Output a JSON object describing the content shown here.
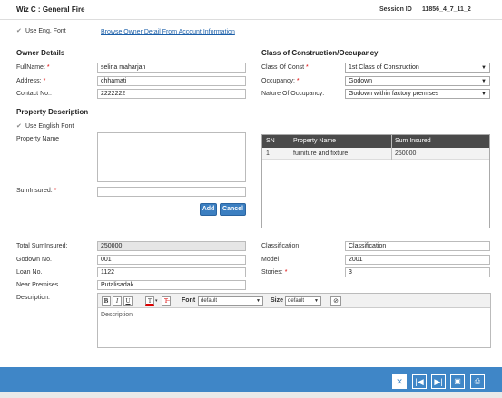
{
  "title": "Wiz C : General Fire",
  "session": {
    "label": "Session ID",
    "value": "11856_4_7_11_2"
  },
  "use_eng_font": {
    "label": "Use Eng. Font",
    "checked": true
  },
  "owner_link": "Browse Owner Detail From Account Information",
  "owner": {
    "heading": "Owner Details",
    "fullname_label": "FullName:",
    "fullname": "selina maharjan",
    "address_label": "Address:",
    "address": "chhamati",
    "contact_label": "Contact No.:",
    "contact": "2222222"
  },
  "construction": {
    "heading": "Class of Construction/Occupancy",
    "class_label": "Class Of Const",
    "class_value": "1st Class of Construction",
    "occupancy_label": "Occupancy:",
    "occupancy_value": "Godown",
    "nature_label": "Nature Of Occupancy:",
    "nature_value": "Godown within factory premises"
  },
  "property": {
    "heading": "Property Description",
    "use_english_label": "Use English Font",
    "name_label": "Property Name",
    "sum_label": "SumInsured:",
    "add_label": "Add",
    "cancel_label": "Cancel"
  },
  "grid": {
    "headers": [
      "SN",
      "Property Name",
      "Sum Insured"
    ],
    "rows": [
      [
        "1",
        "furniture and fixture",
        "250000"
      ]
    ]
  },
  "details": {
    "total_label": "Total SumInsured:",
    "total": "250000",
    "godown_label": "Godown No.",
    "godown": "001",
    "loan_label": "Loan No.",
    "loan": "1122",
    "near_label": "Near Premises",
    "near": "Putalisadak",
    "description_label": "Description:",
    "classification_label": "Classification",
    "classification": "Classification",
    "model_label": "Model",
    "model": "2001",
    "stories_label": "Stories:",
    "stories": "3"
  },
  "editor": {
    "font_label": "Font",
    "font_value": "default",
    "size_label": "Size",
    "size_value": "default",
    "text": "Description"
  },
  "icons": [
    "close-icon",
    "first-icon",
    "last-icon",
    "save-icon",
    "print-icon"
  ],
  "colors": {
    "footer": "#3f86c7",
    "grid_header": "#4a4a4a",
    "button": "#3c7fc1"
  }
}
